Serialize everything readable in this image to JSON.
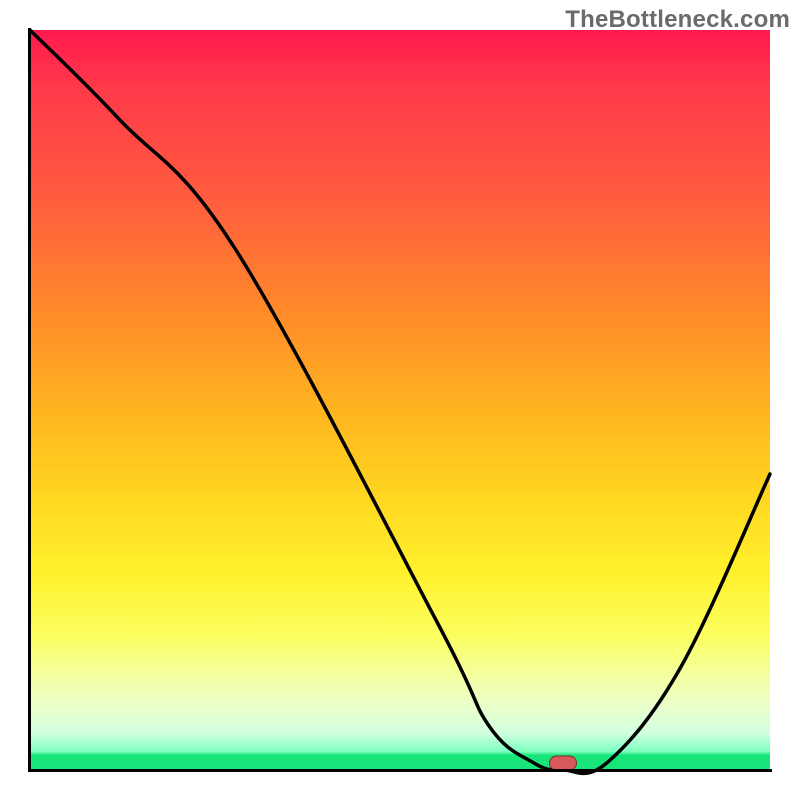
{
  "watermark": "TheBottleneck.com",
  "chart_data": {
    "type": "line",
    "title": "",
    "xlabel": "",
    "ylabel": "",
    "xlim": [
      0,
      100
    ],
    "ylim": [
      0,
      100
    ],
    "grid": false,
    "legend": false,
    "background_gradient": {
      "direction": "vertical",
      "stops": [
        {
          "pos": 0,
          "color": "#ff1a4d"
        },
        {
          "pos": 40,
          "color": "#ff8a2a"
        },
        {
          "pos": 70,
          "color": "#fff22e"
        },
        {
          "pos": 92,
          "color": "#e7ffcf"
        },
        {
          "pos": 100,
          "color": "#17e57a"
        }
      ]
    },
    "series": [
      {
        "name": "bottleneck-curve",
        "color": "#000000",
        "x": [
          0,
          12,
          28,
          55,
          62,
          68,
          72,
          78,
          88,
          100
        ],
        "y": [
          100,
          88,
          70,
          20,
          6,
          1,
          0,
          1,
          14,
          40
        ]
      }
    ],
    "marker": {
      "name": "optimal-point",
      "x": 72,
      "y": 1,
      "color": "#d95a5a"
    }
  }
}
